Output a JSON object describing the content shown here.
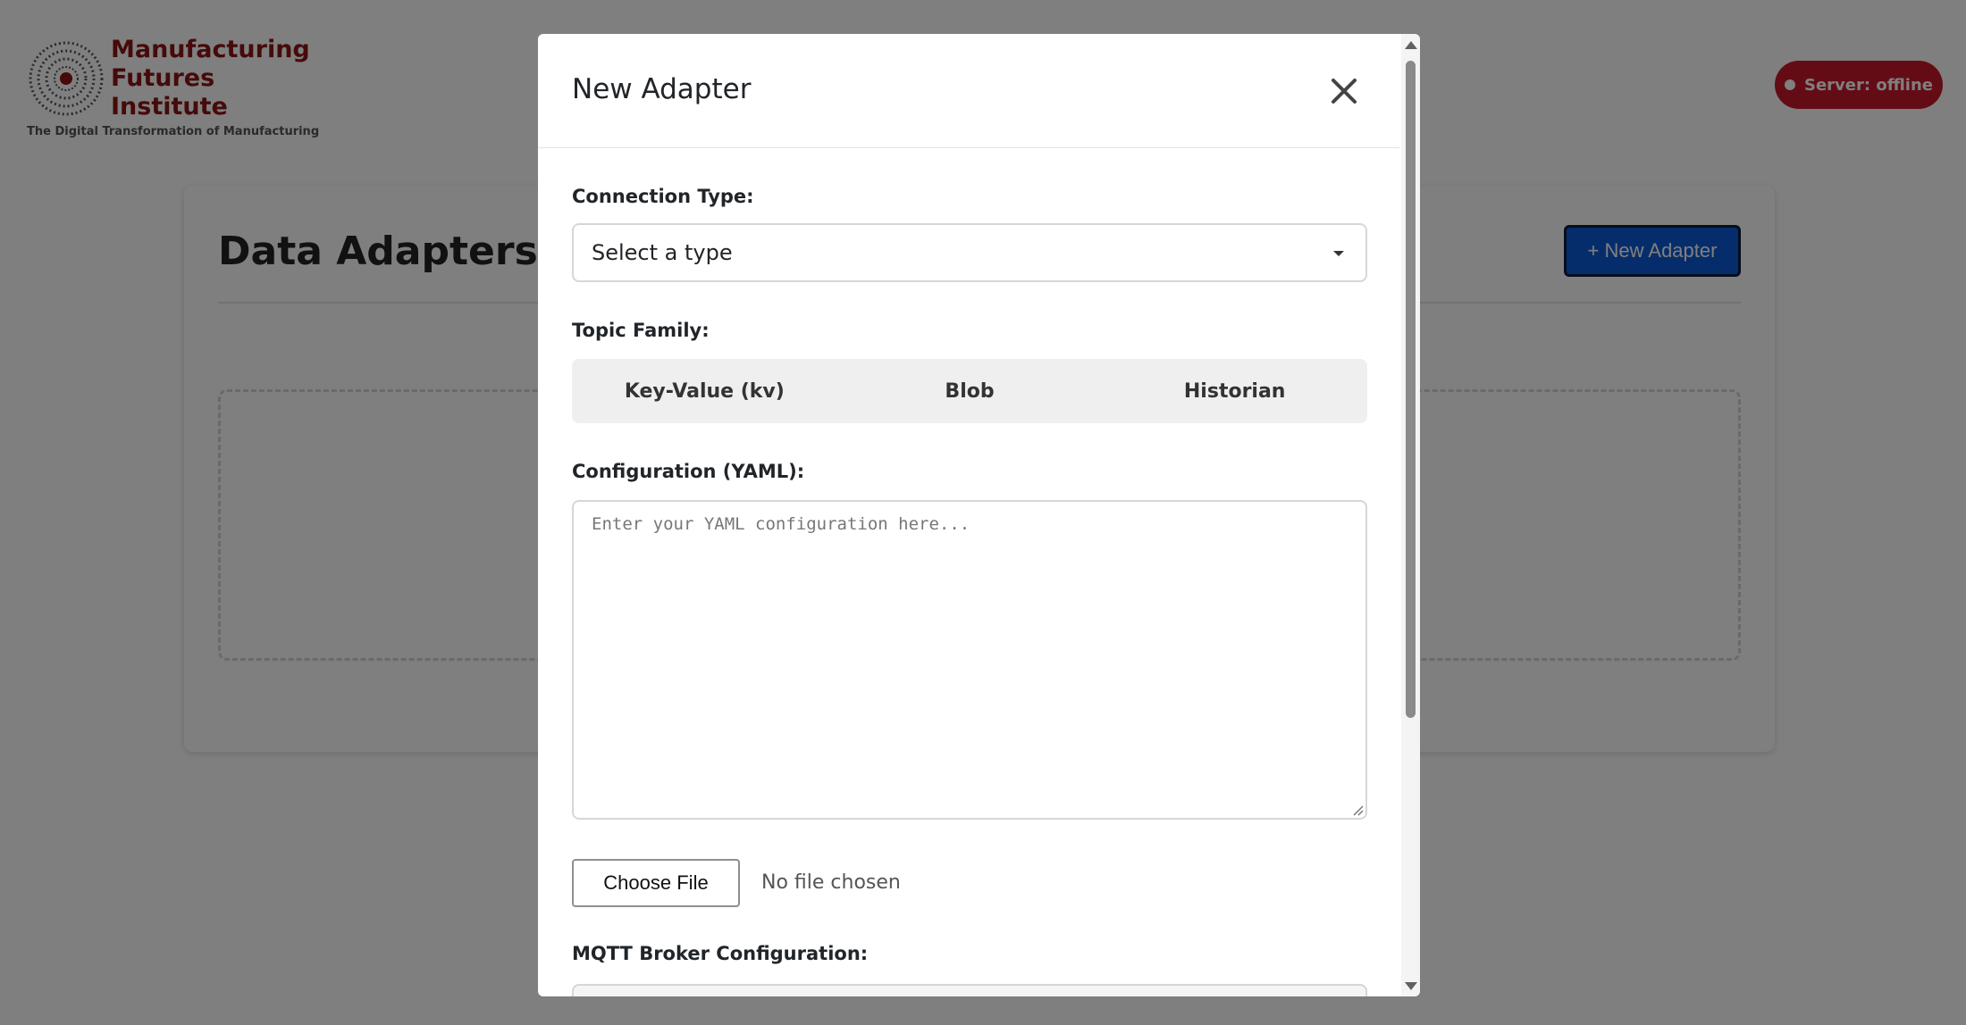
{
  "brand": {
    "name_lines": [
      "Manufacturing",
      "Futures",
      "Institute"
    ],
    "tagline": "The Digital Transformation of Manufacturing",
    "accent_color": "#8c1515"
  },
  "server": {
    "status": "Server: offline",
    "color": "#c9182b"
  },
  "page": {
    "title": "Data Adapters",
    "new_adapter_label": "+ New Adapter"
  },
  "modal": {
    "title": "New Adapter",
    "close_icon": "close-icon",
    "connection_type": {
      "label": "Connection Type:",
      "selected": "Select a type"
    },
    "topic_family": {
      "label": "Topic Family:",
      "options": [
        "Key-Value (kv)",
        "Blob",
        "Historian"
      ]
    },
    "configuration": {
      "label": "Configuration (YAML):",
      "placeholder": "Enter your YAML configuration here..."
    },
    "file": {
      "button_label": "Choose File",
      "status": "No file chosen"
    },
    "mqtt": {
      "label": "MQTT Broker Configuration:"
    }
  }
}
